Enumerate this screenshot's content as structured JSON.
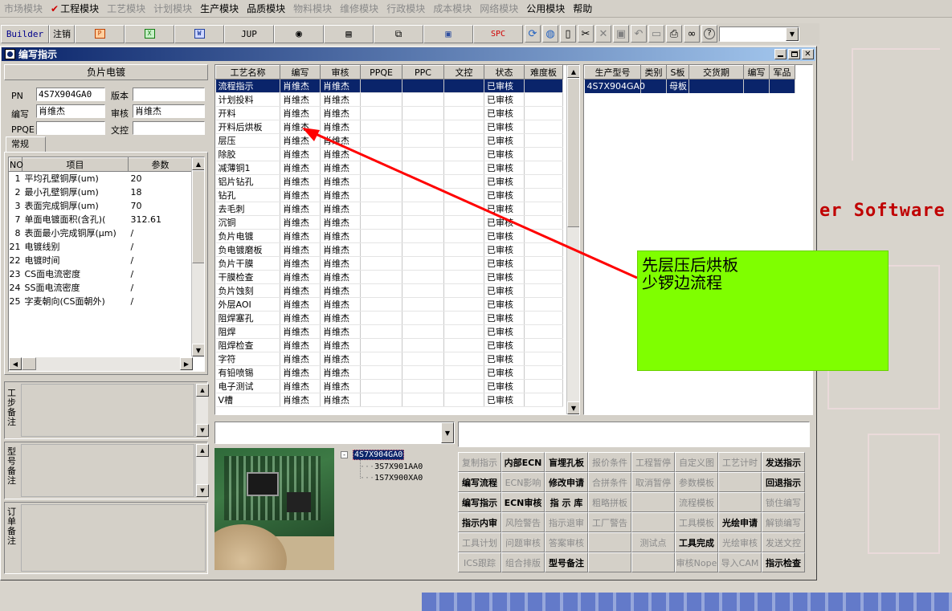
{
  "menubar": [
    "市场模块",
    "工程模块",
    "工艺模块",
    "计划模块",
    "生产模块",
    "品质模块",
    "物料模块",
    "维修模块",
    "行政模块",
    "成本模块",
    "网络模块",
    "公用模块",
    "帮助"
  ],
  "menubar_enabled": [
    false,
    true,
    false,
    false,
    true,
    true,
    false,
    false,
    false,
    false,
    false,
    true,
    true
  ],
  "toolbar": {
    "builder": "Builder",
    "logout": "注销",
    "jup": "JUP",
    "spc": "SPC"
  },
  "window": {
    "title": "编写指示"
  },
  "left": {
    "header": "负片电镀",
    "pn_label": "PN",
    "pn_value": "4S7X904GA0",
    "version_label": "版本",
    "version_value": "",
    "writer_label": "编写",
    "writer_value": "肖维杰",
    "reviewer_label": "审核",
    "reviewer_value": "肖维杰",
    "ppqe_label": "PPQE",
    "ppqe_value": "",
    "docctl_label": "文控",
    "docctl_value": "",
    "tab": "常规",
    "param_cols": [
      "NO",
      "项目",
      "参数"
    ],
    "params": [
      [
        "1",
        "平均孔壁铜厚(um)",
        "20"
      ],
      [
        "2",
        "最小孔壁铜厚(um)",
        "18"
      ],
      [
        "3",
        "表面完成铜厚(um)",
        "70"
      ],
      [
        "7",
        "单面电镀面积(含孔)(",
        "312.61"
      ],
      [
        "8",
        "表面最小完成铜厚(μm)",
        "/"
      ],
      [
        "21",
        "电镀线别",
        "/"
      ],
      [
        "22",
        "电镀时间",
        "/"
      ],
      [
        "23",
        "CS面电流密度",
        "/"
      ],
      [
        "24",
        "SS面电流密度",
        "/"
      ],
      [
        "25",
        "字麦朝向(CS面朝外)",
        "/"
      ]
    ],
    "note1": "工步备注",
    "note2": "型号备注",
    "note3": "订单备注"
  },
  "grid": {
    "columns": [
      "工艺名称",
      "编写",
      "审核",
      "PPQE",
      "PPC",
      "文控",
      "状态",
      "难度板"
    ],
    "rows": [
      [
        "流程指示",
        "肖维杰",
        "肖维杰",
        "",
        "",
        "",
        "已审核",
        ""
      ],
      [
        "计划投料",
        "肖维杰",
        "肖维杰",
        "",
        "",
        "",
        "已审核",
        ""
      ],
      [
        "开料",
        "肖维杰",
        "肖维杰",
        "",
        "",
        "",
        "已审核",
        ""
      ],
      [
        "开料后烘板",
        "肖维杰",
        "肖维杰",
        "",
        "",
        "",
        "已审核",
        ""
      ],
      [
        "层压",
        "肖维杰",
        "肖维杰",
        "",
        "",
        "",
        "已审核",
        ""
      ],
      [
        "除胶",
        "肖维杰",
        "肖维杰",
        "",
        "",
        "",
        "已审核",
        ""
      ],
      [
        "减薄铜1",
        "肖维杰",
        "肖维杰",
        "",
        "",
        "",
        "已审核",
        ""
      ],
      [
        "铝片钻孔",
        "肖维杰",
        "肖维杰",
        "",
        "",
        "",
        "已审核",
        ""
      ],
      [
        "钻孔",
        "肖维杰",
        "肖维杰",
        "",
        "",
        "",
        "已审核",
        ""
      ],
      [
        "去毛刺",
        "肖维杰",
        "肖维杰",
        "",
        "",
        "",
        "已审核",
        ""
      ],
      [
        "沉铜",
        "肖维杰",
        "肖维杰",
        "",
        "",
        "",
        "已审核",
        ""
      ],
      [
        "负片电镀",
        "肖维杰",
        "肖维杰",
        "",
        "",
        "",
        "已审核",
        ""
      ],
      [
        "负电镀磨板",
        "肖维杰",
        "肖维杰",
        "",
        "",
        "",
        "已审核",
        ""
      ],
      [
        "负片干膜",
        "肖维杰",
        "肖维杰",
        "",
        "",
        "",
        "已审核",
        ""
      ],
      [
        "干膜检查",
        "肖维杰",
        "肖维杰",
        "",
        "",
        "",
        "已审核",
        ""
      ],
      [
        "负片蚀刻",
        "肖维杰",
        "肖维杰",
        "",
        "",
        "",
        "已审核",
        ""
      ],
      [
        "外层AOI",
        "肖维杰",
        "肖维杰",
        "",
        "",
        "",
        "已审核",
        ""
      ],
      [
        "阻焊塞孔",
        "肖维杰",
        "肖维杰",
        "",
        "",
        "",
        "已审核",
        ""
      ],
      [
        "阻焊",
        "肖维杰",
        "肖维杰",
        "",
        "",
        "",
        "已审核",
        ""
      ],
      [
        "阻焊检查",
        "肖维杰",
        "肖维杰",
        "",
        "",
        "",
        "已审核",
        ""
      ],
      [
        "字符",
        "肖维杰",
        "肖维杰",
        "",
        "",
        "",
        "已审核",
        ""
      ],
      [
        "有铅喷锡",
        "肖维杰",
        "肖维杰",
        "",
        "",
        "",
        "已审核",
        ""
      ],
      [
        "电子测试",
        "肖维杰",
        "肖维杰",
        "",
        "",
        "",
        "已审核",
        ""
      ],
      [
        "V槽",
        "肖维杰",
        "肖维杰",
        "",
        "",
        "",
        "已审核",
        ""
      ]
    ]
  },
  "grid2": {
    "columns": [
      "生产型号",
      "类别",
      "S板",
      "交货期",
      "编写",
      "军品"
    ],
    "rows": [
      [
        "4S7X904GA0",
        "",
        "母板",
        "",
        "",
        ""
      ]
    ]
  },
  "tree": {
    "root": "4S7X904GA0",
    "children": [
      "3S7X901AA0",
      "1S7X900XA0"
    ]
  },
  "buttons": [
    [
      "复制指示",
      "内部ECN",
      "盲埋孔板",
      "报价条件",
      "工程暂停",
      "自定义图",
      "工艺计时",
      "发送指示"
    ],
    [
      "编写流程",
      "ECN影响",
      "修改申请",
      "合拼条件",
      "取消暂停",
      "参数模板",
      "",
      "回退指示"
    ],
    [
      "编写指示",
      "ECN审核",
      "指 示 库",
      "粗略拼板",
      "",
      "流程模板",
      "",
      "锁住编写"
    ],
    [
      "指示内审",
      "风险警告",
      "指示退审",
      "工厂警告",
      "",
      "工具模板",
      "光绘申请",
      "解锁编写"
    ],
    [
      "工具计划",
      "问题审核",
      "答案审核",
      "",
      "测试点",
      "工具完成",
      "光绘审核",
      "发送文控"
    ],
    [
      "ICS跟踪",
      "组合排版",
      "型号备注",
      "",
      "",
      "审核Nope",
      "导入CAM",
      "指示检查"
    ]
  ],
  "buttons_enabled": [
    [
      0,
      1,
      1,
      0,
      0,
      0,
      0,
      1
    ],
    [
      1,
      0,
      1,
      0,
      0,
      0,
      0,
      1
    ],
    [
      1,
      1,
      1,
      0,
      0,
      0,
      0,
      0
    ],
    [
      1,
      0,
      0,
      0,
      0,
      0,
      1,
      0
    ],
    [
      0,
      0,
      0,
      0,
      0,
      1,
      0,
      0
    ],
    [
      0,
      0,
      1,
      0,
      0,
      0,
      0,
      1
    ]
  ],
  "annotation": {
    "line1": "先层压后烘板",
    "line2": "少锣边流程",
    "color": "#7fff00",
    "arrow_color": "#ff0000"
  },
  "background_text": "er Software"
}
